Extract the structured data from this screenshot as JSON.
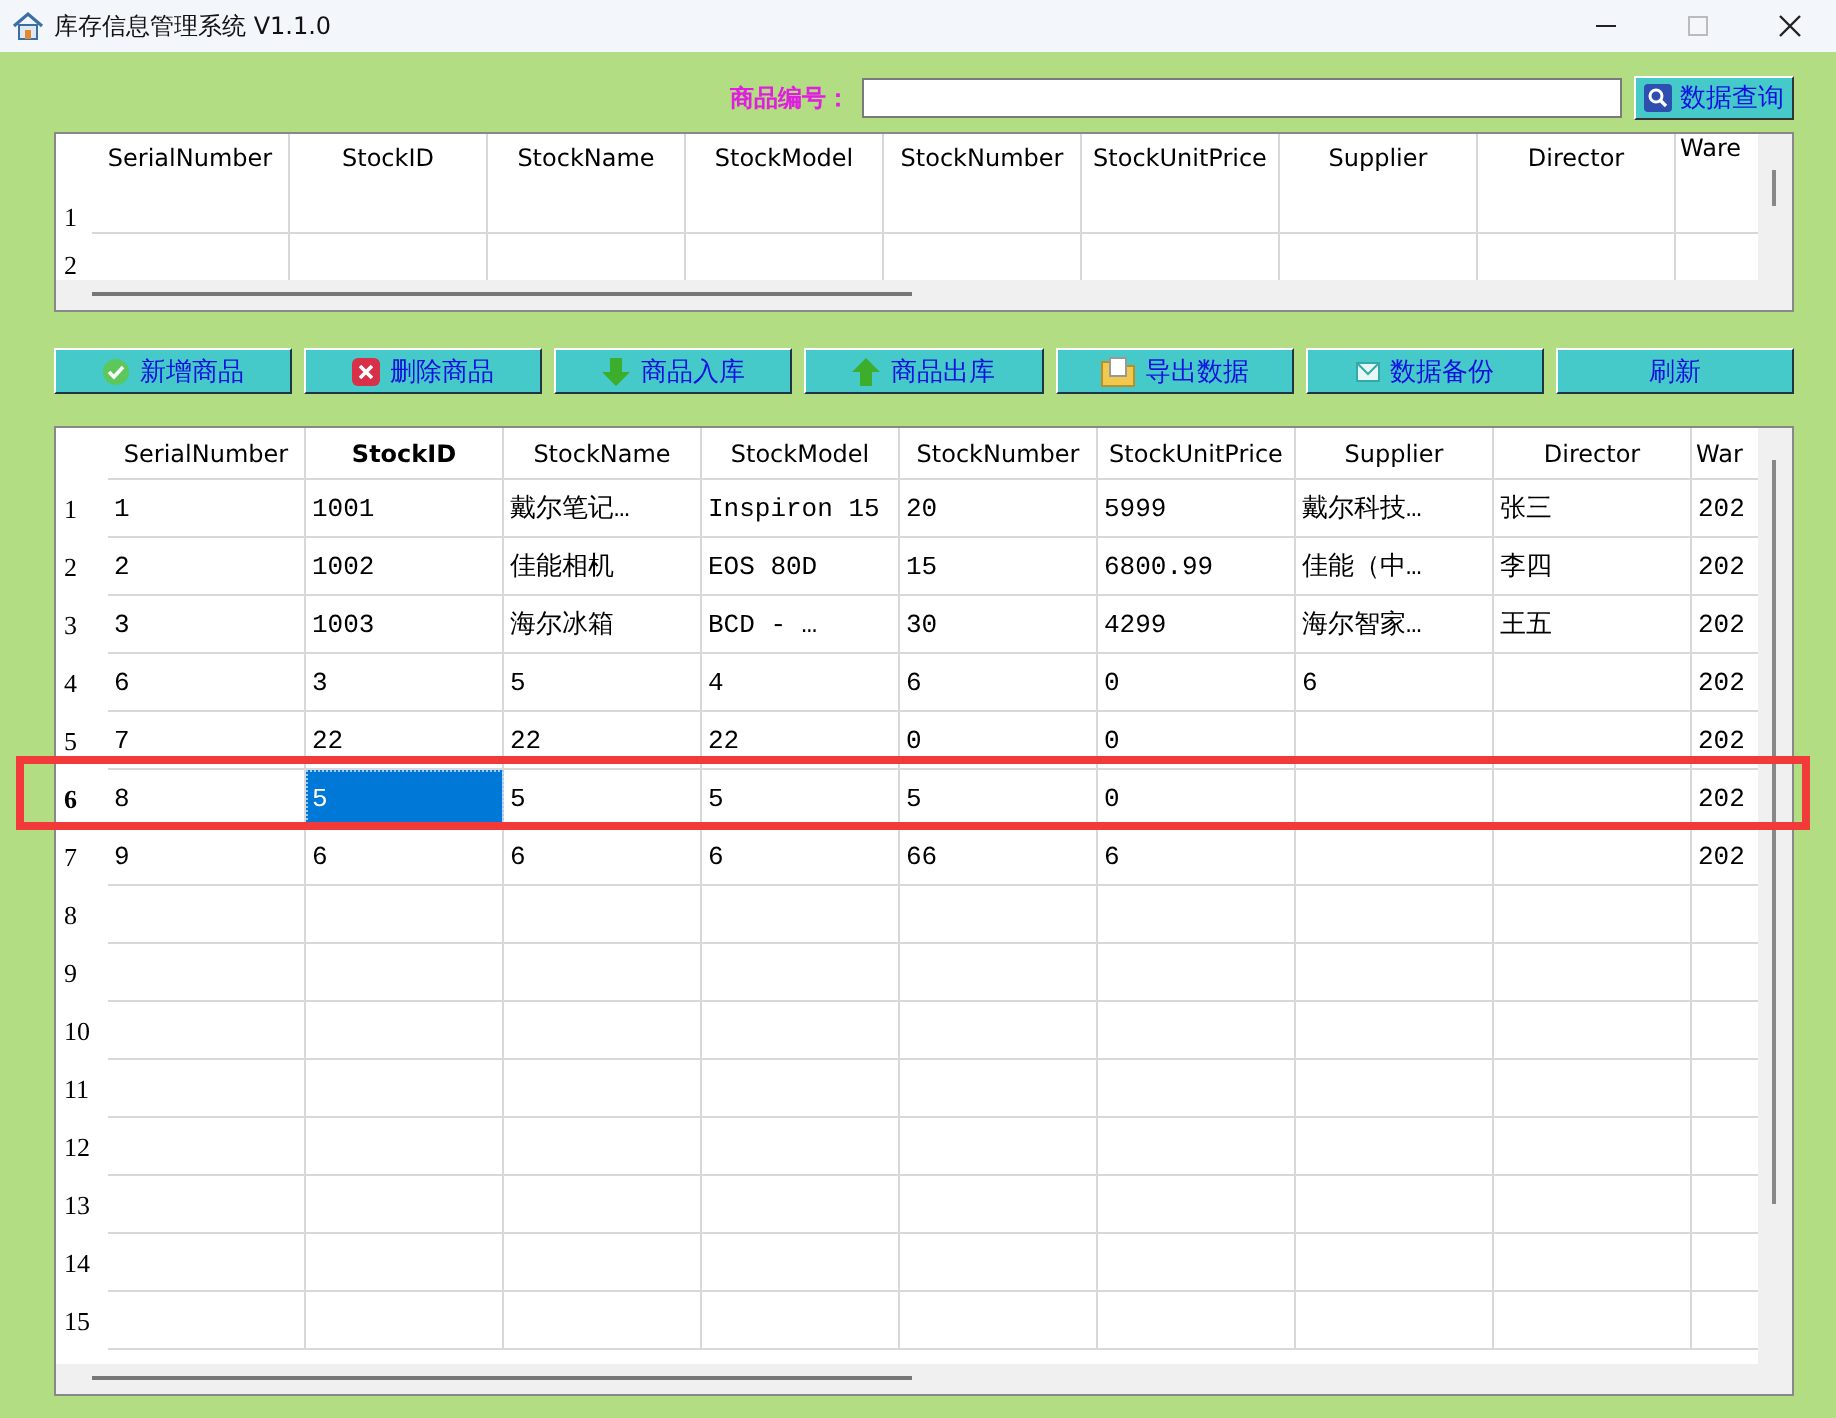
{
  "window": {
    "title": "库存信息管理系统 V1.1.0"
  },
  "search": {
    "label": "商品编号：",
    "button": "数据查询"
  },
  "lookup_table": {
    "columns": [
      {
        "label": "SerialNumber",
        "selected": false
      },
      {
        "label": "StockID",
        "selected": false
      },
      {
        "label": "StockName",
        "selected": false
      },
      {
        "label": "StockModel",
        "selected": false
      },
      {
        "label": "StockNumber",
        "selected": false
      },
      {
        "label": "StockUnitPrice",
        "selected": false
      },
      {
        "label": "Supplier",
        "selected": false
      },
      {
        "label": "Director",
        "selected": false
      },
      {
        "label": "Ware",
        "selected": false
      }
    ],
    "rows": [
      {
        "header": "1",
        "selected": false,
        "outlined": false
      },
      {
        "header": "2",
        "selected": false,
        "outlined": false
      }
    ]
  },
  "toolbar": [
    "新增商品",
    "删除商品",
    "商品入库",
    "商品出库",
    "导出数据",
    "数据备份",
    "刷新"
  ],
  "stock_table": {
    "columns": [
      {
        "label": "SerialNumber",
        "selected": false
      },
      {
        "label": "StockID",
        "selected": true
      },
      {
        "label": "StockName",
        "selected": false
      },
      {
        "label": "StockModel",
        "selected": false
      },
      {
        "label": "StockNumber",
        "selected": false
      },
      {
        "label": "StockUnitPrice",
        "selected": false
      },
      {
        "label": "Supplier",
        "selected": false
      },
      {
        "label": "Director",
        "selected": false
      },
      {
        "label": "War",
        "selected": false
      }
    ],
    "rows": [
      {
        "header": "1",
        "selected": false,
        "outlined": false,
        "cells": [
          "1",
          "1001",
          "戴尔笔记…",
          "Inspiron 15",
          "20",
          "5999",
          "戴尔科技…",
          "张三",
          "202"
        ]
      },
      {
        "header": "2",
        "selected": false,
        "outlined": false,
        "cells": [
          "2",
          "1002",
          "佳能相机",
          "EOS 80D",
          "15",
          "6800.99",
          "佳能（中…",
          "李四",
          "202"
        ]
      },
      {
        "header": "3",
        "selected": false,
        "outlined": false,
        "cells": [
          "3",
          "1003",
          "海尔冰箱",
          "BCD - …",
          "30",
          "4299",
          "海尔智家…",
          "王五",
          "202"
        ]
      },
      {
        "header": "4",
        "selected": false,
        "outlined": false,
        "cells": [
          "6",
          "3",
          "5",
          "4",
          "6",
          "0",
          "6",
          null,
          "202"
        ]
      },
      {
        "header": "5",
        "selected": false,
        "outlined": false,
        "cells": [
          "7",
          "22",
          "22",
          "22",
          "0",
          "0",
          null,
          null,
          "202"
        ]
      },
      {
        "header": "6",
        "selected": true,
        "outlined": true,
        "cells": [
          "8",
          "5",
          "5",
          "5",
          "5",
          "0",
          null,
          null,
          "202"
        ]
      },
      {
        "header": "7",
        "selected": false,
        "outlined": false,
        "cells": [
          "9",
          "6",
          "6",
          "6",
          "66",
          "6",
          null,
          null,
          "202"
        ]
      },
      {
        "header": "8",
        "selected": false,
        "outlined": false
      },
      {
        "header": "9",
        "selected": false,
        "outlined": false
      },
      {
        "header": "10",
        "selected": false,
        "outlined": false
      },
      {
        "header": "11",
        "selected": false,
        "outlined": false
      },
      {
        "header": "12",
        "selected": false,
        "outlined": false
      },
      {
        "header": "13",
        "selected": false,
        "outlined": false
      },
      {
        "header": "14",
        "selected": false,
        "outlined": false
      },
      {
        "header": "15",
        "selected": false,
        "outlined": false
      }
    ]
  }
}
